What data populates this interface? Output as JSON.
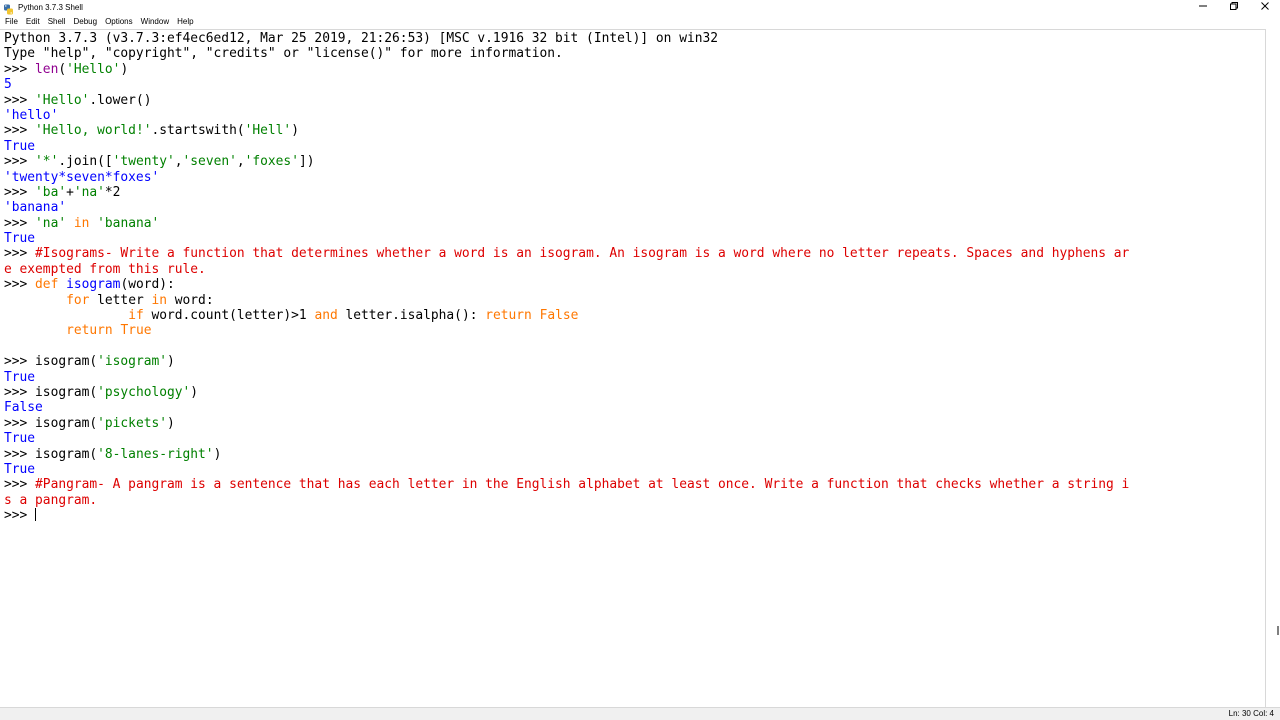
{
  "window": {
    "title": "Python 3.7.3 Shell",
    "controls": {
      "minimize": "—",
      "restore": "❐",
      "close": "✕"
    }
  },
  "menubar": {
    "items": [
      "File",
      "Edit",
      "Shell",
      "Debug",
      "Options",
      "Window",
      "Help"
    ]
  },
  "shell": {
    "lines": [
      [
        {
          "t": "Python 3.7.3 (v3.7.3:ef4ec6ed12, Mar 25 2019, 21:26:53) [MSC v.1916 32 bit (Intel)] on win32",
          "c": "plain"
        }
      ],
      [
        {
          "t": "Type \"help\", \"copyright\", \"credits\" or \"license()\" for more information.",
          "c": "plain"
        }
      ],
      [
        {
          "t": ">>> ",
          "c": "prompt"
        },
        {
          "t": "len",
          "c": "bi"
        },
        {
          "t": "(",
          "c": "plain"
        },
        {
          "t": "'Hello'",
          "c": "str"
        },
        {
          "t": ")",
          "c": "plain"
        }
      ],
      [
        {
          "t": "5",
          "c": "out"
        }
      ],
      [
        {
          "t": ">>> ",
          "c": "prompt"
        },
        {
          "t": "'Hello'",
          "c": "str"
        },
        {
          "t": ".lower()",
          "c": "plain"
        }
      ],
      [
        {
          "t": "'hello'",
          "c": "out"
        }
      ],
      [
        {
          "t": ">>> ",
          "c": "prompt"
        },
        {
          "t": "'Hello, world!'",
          "c": "str"
        },
        {
          "t": ".startswith(",
          "c": "plain"
        },
        {
          "t": "'Hell'",
          "c": "str"
        },
        {
          "t": ")",
          "c": "plain"
        }
      ],
      [
        {
          "t": "True",
          "c": "out"
        }
      ],
      [
        {
          "t": ">>> ",
          "c": "prompt"
        },
        {
          "t": "'*'",
          "c": "str"
        },
        {
          "t": ".join([",
          "c": "plain"
        },
        {
          "t": "'twenty'",
          "c": "str"
        },
        {
          "t": ",",
          "c": "plain"
        },
        {
          "t": "'seven'",
          "c": "str"
        },
        {
          "t": ",",
          "c": "plain"
        },
        {
          "t": "'foxes'",
          "c": "str"
        },
        {
          "t": "])",
          "c": "plain"
        }
      ],
      [
        {
          "t": "'twenty*seven*foxes'",
          "c": "out"
        }
      ],
      [
        {
          "t": ">>> ",
          "c": "prompt"
        },
        {
          "t": "'ba'",
          "c": "str"
        },
        {
          "t": "+",
          "c": "plain"
        },
        {
          "t": "'na'",
          "c": "str"
        },
        {
          "t": "*2",
          "c": "plain"
        }
      ],
      [
        {
          "t": "'banana'",
          "c": "out"
        }
      ],
      [
        {
          "t": ">>> ",
          "c": "prompt"
        },
        {
          "t": "'na'",
          "c": "str"
        },
        {
          "t": " ",
          "c": "plain"
        },
        {
          "t": "in",
          "c": "kw"
        },
        {
          "t": " ",
          "c": "plain"
        },
        {
          "t": "'banana'",
          "c": "str"
        }
      ],
      [
        {
          "t": "True",
          "c": "out"
        }
      ],
      [
        {
          "t": ">>> ",
          "c": "prompt"
        },
        {
          "t": "#Isograms- Write a function that determines whether a word is an isogram. An isogram is a word where no letter repeats. Spaces and hyphens ar",
          "c": "cmt"
        }
      ],
      [
        {
          "t": "e exempted from this rule.",
          "c": "cmt"
        }
      ],
      [
        {
          "t": ">>> ",
          "c": "prompt"
        },
        {
          "t": "def",
          "c": "kw"
        },
        {
          "t": " ",
          "c": "plain"
        },
        {
          "t": "isogram",
          "c": "def"
        },
        {
          "t": "(word):",
          "c": "plain"
        }
      ],
      [
        {
          "t": "        ",
          "c": "plain"
        },
        {
          "t": "for",
          "c": "kw"
        },
        {
          "t": " letter ",
          "c": "plain"
        },
        {
          "t": "in",
          "c": "kw"
        },
        {
          "t": " word:",
          "c": "plain"
        }
      ],
      [
        {
          "t": "                ",
          "c": "plain"
        },
        {
          "t": "if",
          "c": "kw"
        },
        {
          "t": " word.count(letter)>1 ",
          "c": "plain"
        },
        {
          "t": "and",
          "c": "kw"
        },
        {
          "t": " letter.isalpha(): ",
          "c": "plain"
        },
        {
          "t": "return",
          "c": "kw"
        },
        {
          "t": " ",
          "c": "plain"
        },
        {
          "t": "False",
          "c": "kw"
        }
      ],
      [
        {
          "t": "        ",
          "c": "plain"
        },
        {
          "t": "return",
          "c": "kw"
        },
        {
          "t": " ",
          "c": "plain"
        },
        {
          "t": "True",
          "c": "kw"
        }
      ],
      [
        {
          "t": "",
          "c": "plain"
        }
      ],
      [
        {
          "t": ">>> ",
          "c": "prompt"
        },
        {
          "t": "isogram(",
          "c": "plain"
        },
        {
          "t": "'isogram'",
          "c": "str"
        },
        {
          "t": ")",
          "c": "plain"
        }
      ],
      [
        {
          "t": "True",
          "c": "out"
        }
      ],
      [
        {
          "t": ">>> ",
          "c": "prompt"
        },
        {
          "t": "isogram(",
          "c": "plain"
        },
        {
          "t": "'psychology'",
          "c": "str"
        },
        {
          "t": ")",
          "c": "plain"
        }
      ],
      [
        {
          "t": "False",
          "c": "out"
        }
      ],
      [
        {
          "t": ">>> ",
          "c": "prompt"
        },
        {
          "t": "isogram(",
          "c": "plain"
        },
        {
          "t": "'pickets'",
          "c": "str"
        },
        {
          "t": ")",
          "c": "plain"
        }
      ],
      [
        {
          "t": "True",
          "c": "out"
        }
      ],
      [
        {
          "t": ">>> ",
          "c": "prompt"
        },
        {
          "t": "isogram(",
          "c": "plain"
        },
        {
          "t": "'8-lanes-right'",
          "c": "str"
        },
        {
          "t": ")",
          "c": "plain"
        }
      ],
      [
        {
          "t": "True",
          "c": "out"
        }
      ],
      [
        {
          "t": ">>> ",
          "c": "prompt"
        },
        {
          "t": "#Pangram- A pangram is a sentence that has each letter in the English alphabet at least once. Write a function that checks whether a string i",
          "c": "cmt"
        }
      ],
      [
        {
          "t": "s a pangram.",
          "c": "cmt"
        }
      ],
      [
        {
          "t": ">>> ",
          "c": "prompt"
        }
      ]
    ]
  },
  "status": {
    "position": "Ln: 30  Col: 4"
  },
  "colors": {
    "string": "#008000",
    "output": "#0000ff",
    "comment": "#dd0000",
    "keyword": "#ff7700",
    "builtin": "#900090"
  }
}
